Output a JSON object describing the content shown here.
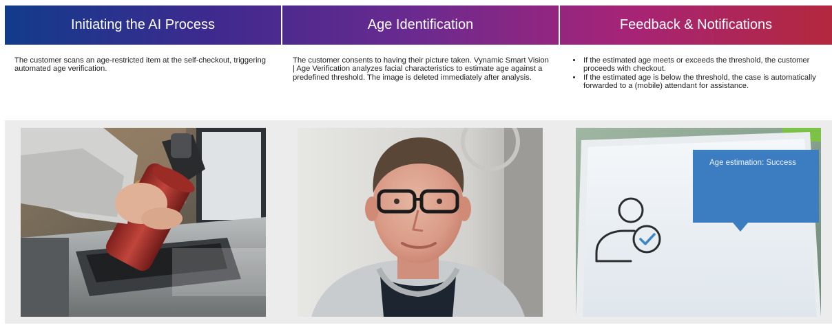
{
  "columns": [
    {
      "header": "Initiating the AI Process",
      "description": "The customer scans an age-restricted item at the self-checkout, triggering automated age verification."
    },
    {
      "header": "Age Identification",
      "description": "The customer consents to having their picture taken. Vynamic Smart Vision | Age Verification analyzes facial characteristics to estimate age against a predefined threshold. The image is deleted immediately after analysis."
    },
    {
      "header": "Feedback & Notifications",
      "bullets": [
        "If the estimated age meets or exceeds the threshold, the customer proceeds with checkout.",
        "If the estimated age is below the threshold, the case is automatically forwarded to a (mobile) attendant for assistance."
      ]
    }
  ],
  "screen_message": "Age estimation: Success",
  "colors": {
    "header_gradient": [
      "#123b8c",
      "#3e2a8e",
      "#6b2a8f",
      "#a62477",
      "#b3283e"
    ],
    "bubble": "#3c7cc1",
    "band": "#ececec"
  },
  "icons": [
    "user-check-icon"
  ]
}
